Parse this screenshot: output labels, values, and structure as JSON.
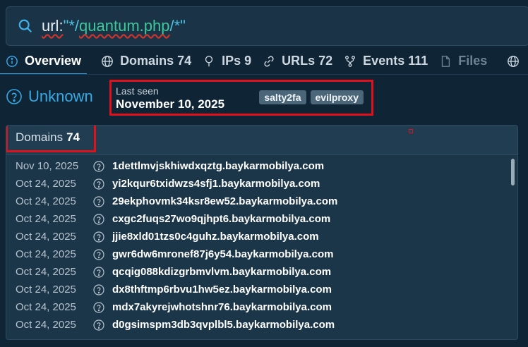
{
  "search": {
    "query_key": "url:",
    "query_quote_open": "\"*/",
    "query_path": "quantum.php",
    "query_tail": "/*\""
  },
  "tabs": [
    {
      "label": "Overview",
      "icon": "info-icon"
    },
    {
      "label": "Domains 74",
      "icon": "globe-icon"
    },
    {
      "label": "IPs 9",
      "icon": "location-pin-icon"
    },
    {
      "label": "URLs 72",
      "icon": "link-icon"
    },
    {
      "label": "Events 111",
      "icon": "fork-icon"
    },
    {
      "label": "Files",
      "icon": "file-icon"
    }
  ],
  "status": {
    "label": "Unknown",
    "icon": "question-circle-icon"
  },
  "last_seen": {
    "label": "Last seen",
    "date": "November 10, 2025",
    "tags": [
      "salty2fa",
      "evilproxy"
    ]
  },
  "panel": {
    "title": "Domains",
    "count": "74",
    "rows": [
      {
        "date": "Nov 10, 2025",
        "domain": "1dettlmvjskhiwdxqztg.baykarmobilya.com"
      },
      {
        "date": "Oct 24, 2025",
        "domain": "yi2kqur6txidwzs4sfj1.baykarmobilya.com"
      },
      {
        "date": "Oct 24, 2025",
        "domain": "29ekphovmk34ksr8ew52.baykarmobilya.com"
      },
      {
        "date": "Oct 24, 2025",
        "domain": "cxgc2fuqs27wo9qjhpt6.baykarmobilya.com"
      },
      {
        "date": "Oct 24, 2025",
        "domain": "jjie8xld01tzs0c4guhz.baykarmobilya.com"
      },
      {
        "date": "Oct 24, 2025",
        "domain": "gwr6dw6mronef87j6y54.baykarmobilya.com"
      },
      {
        "date": "Oct 24, 2025",
        "domain": "qcqig088kdizgrbmvlvm.baykarmobilya.com"
      },
      {
        "date": "Oct 24, 2025",
        "domain": "dx8thftmp6rbvu1hw5ez.baykarmobilya.com"
      },
      {
        "date": "Oct 24, 2025",
        "domain": "mdx7akyrejwhotshnr76.baykarmobilya.com"
      },
      {
        "date": "Oct 24, 2025",
        "domain": "d0gsimspm3db3qvplbl5.baykarmobilya.com"
      }
    ]
  },
  "colors": {
    "accent": "#3aa6e8",
    "highlight": "#e0111b",
    "status": "#38a9e4"
  }
}
